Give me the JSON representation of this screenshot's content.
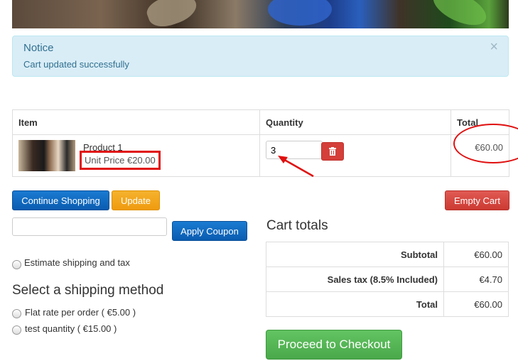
{
  "notice": {
    "title": "Notice",
    "message": "Cart updated successfully",
    "close_glyph": "×"
  },
  "cart_table": {
    "headers": [
      "Item",
      "Quantity",
      "Total"
    ],
    "rows": [
      {
        "name": "Product 1",
        "unit_price": "Unit Price €20.00",
        "quantity": "3",
        "total": "€60.00"
      }
    ]
  },
  "buttons": {
    "continue": "Continue Shopping",
    "update": "Update",
    "empty": "Empty Cart",
    "coupon": "Apply Coupon",
    "checkout": "Proceed to Checkout"
  },
  "coupon": {
    "value": ""
  },
  "estimate_label": "Estimate shipping and tax",
  "shipping": {
    "heading": "Select a shipping method",
    "options": [
      "Flat rate per order ( €5.00 )",
      "test quantity ( €15.00 )"
    ]
  },
  "totals": {
    "heading": "Cart totals",
    "rows": [
      {
        "label": "Subtotal",
        "value": "€60.00"
      },
      {
        "label": "Sales tax (8.5% Included)",
        "value": "€4.70"
      },
      {
        "label": "Total",
        "value": "€60.00"
      }
    ]
  },
  "colors": {
    "primary": "#0a5cb0",
    "warning": "#ef9b0f",
    "danger": "#cc3a33",
    "success": "#4aa84a",
    "annotation": "#e01010"
  }
}
